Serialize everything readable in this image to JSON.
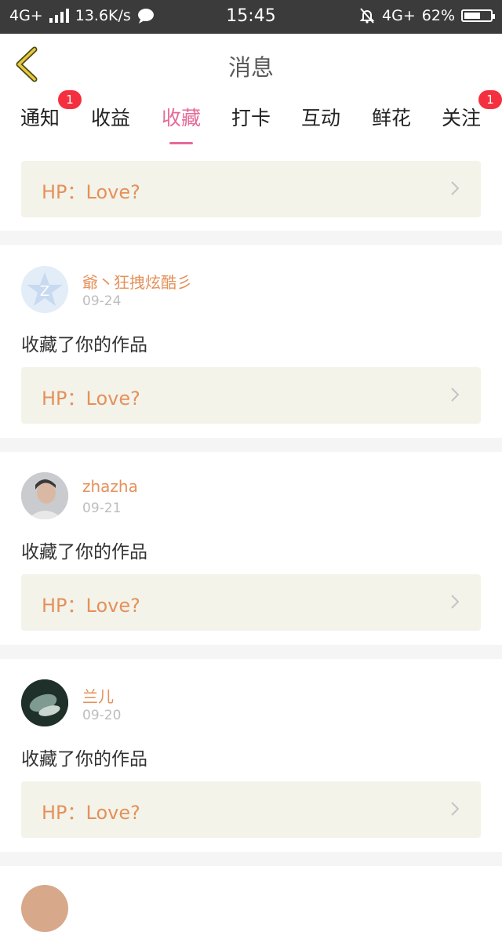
{
  "status_bar": {
    "network": "4G+",
    "speed": "13.6K/s",
    "time": "15:45",
    "network_right": "4G+",
    "battery": "62%",
    "battery_level": 0.62
  },
  "header": {
    "title": "消息"
  },
  "tabs": [
    {
      "label": "通知",
      "badge": "1"
    },
    {
      "label": "收益",
      "badge": ""
    },
    {
      "label": "收藏",
      "badge": "",
      "active": true
    },
    {
      "label": "打卡",
      "badge": ""
    },
    {
      "label": "互动",
      "badge": ""
    },
    {
      "label": "鲜花",
      "badge": ""
    },
    {
      "label": "关注",
      "badge": "1"
    }
  ],
  "feed": {
    "top_card": {
      "text": "HP：Love?"
    },
    "items": [
      {
        "user": "爺丶狂拽炫酷彡",
        "date": "09-24",
        "action": "收藏了你的作品",
        "work": "HP：Love?"
      },
      {
        "user": "zhazha",
        "date": "09-21",
        "action": "收藏了你的作品",
        "work": "HP：Love?"
      },
      {
        "user": "兰儿",
        "date": "09-20",
        "action": "收藏了你的作品",
        "work": "HP：Love?"
      }
    ]
  },
  "colors": {
    "accent": "#e56a9a",
    "name": "#e4915a",
    "badge": "#f5303e",
    "card_bg": "#f3f3ea",
    "status_bar": "#3b3b3b"
  },
  "icons": [
    "back-chevron-icon",
    "signal-bars-icon",
    "chat-bubble-icon",
    "mute-bell-icon",
    "battery-icon",
    "chevron-right-icon"
  ]
}
